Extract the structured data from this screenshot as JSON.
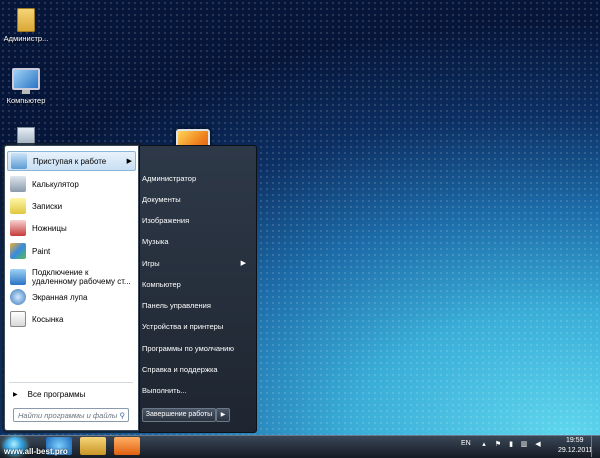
{
  "desktop": {
    "icons": [
      {
        "label": "Администр..."
      },
      {
        "label": "Компьютер"
      },
      {
        "label": ""
      }
    ]
  },
  "start_menu": {
    "programs": [
      {
        "label": "Приступая к работе",
        "icon": "getting-started-icon",
        "has_submenu": true
      },
      {
        "label": "Калькулятор",
        "icon": "calculator-icon"
      },
      {
        "label": "Записки",
        "icon": "sticky-notes-icon"
      },
      {
        "label": "Ножницы",
        "icon": "snipping-tool-icon"
      },
      {
        "label": "Paint",
        "icon": "paint-icon"
      },
      {
        "label": "Подключение к удаленному рабочему ст...",
        "icon": "remote-desktop-icon"
      },
      {
        "label": "Экранная лупа",
        "icon": "magnifier-icon"
      },
      {
        "label": "Косынка",
        "icon": "solitaire-icon"
      }
    ],
    "all_programs_label": "Все программы",
    "search_placeholder": "Найти программы и файлы",
    "right_items": [
      {
        "label": "Администратор"
      },
      {
        "label": "Документы"
      },
      {
        "label": "Изображения"
      },
      {
        "label": "Музыка"
      },
      {
        "label": "Игры",
        "has_submenu": true
      },
      {
        "label": "Компьютер"
      },
      {
        "label": "Панель управления"
      },
      {
        "label": "Устройства и принтеры"
      },
      {
        "label": "Программы по умолчанию"
      },
      {
        "label": "Справка и поддержка"
      },
      {
        "label": "Выполнить..."
      }
    ],
    "shutdown_label": "Завершение работы"
  },
  "taskbar": {
    "watermark": "www.all-best.pro",
    "lang": "EN",
    "time": "19:59",
    "date": "29.12.2011",
    "pinned": [
      "internet-explorer-icon",
      "explorer-icon",
      "media-player-icon"
    ]
  },
  "colors": {
    "accent": "#3aa5e0",
    "highlight": "#c9dff3",
    "menu_dark": "#1e2530"
  }
}
